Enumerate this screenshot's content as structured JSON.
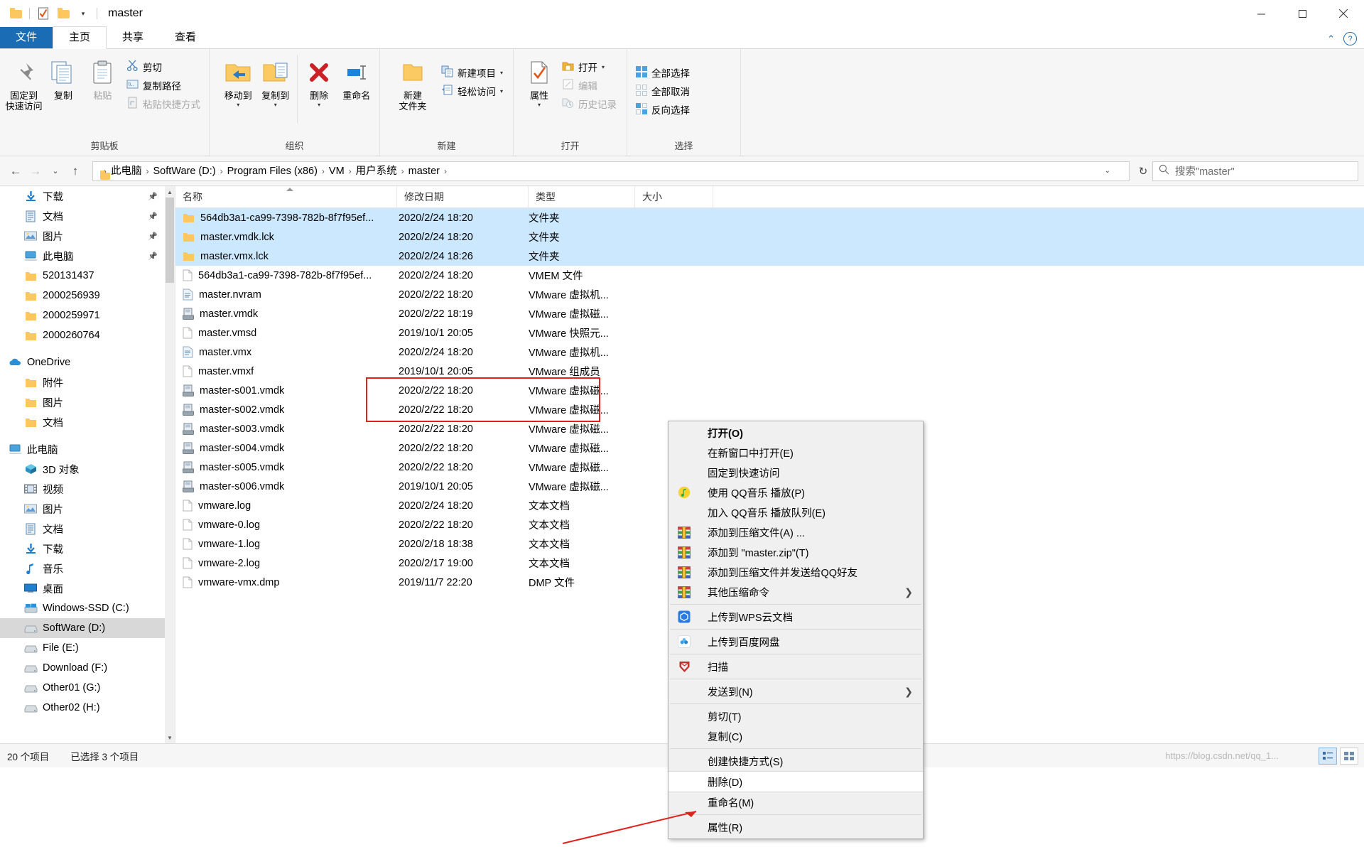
{
  "window": {
    "title": "master",
    "minimize": "—",
    "maximize": "❐",
    "close": "✕",
    "qat_icons": [
      "folder-icon",
      "properties-check-icon",
      "new-folder-icon",
      "customize-dropdown-icon"
    ]
  },
  "tabs": [
    {
      "label": "文件",
      "kind": "file"
    },
    {
      "label": "主页",
      "kind": "active"
    },
    {
      "label": "共享",
      "kind": "normal"
    },
    {
      "label": "查看",
      "kind": "normal"
    }
  ],
  "ribbon_right": {
    "collapse": "⌃",
    "help": "?"
  },
  "ribbon": {
    "groups": [
      {
        "label": "剪贴板",
        "big": [
          {
            "label": "固定到\n快速访问",
            "icon": "pin-icon",
            "disabled": false
          },
          {
            "label": "复制",
            "icon": "copy-icon",
            "disabled": false
          },
          {
            "label": "粘贴",
            "icon": "paste-icon",
            "disabled": true
          }
        ],
        "small": [
          {
            "label": "剪切",
            "icon": "scissors-icon",
            "disabled": false
          },
          {
            "label": "复制路径",
            "icon": "copy-path-icon",
            "disabled": false
          },
          {
            "label": "粘贴快捷方式",
            "icon": "paste-shortcut-icon",
            "disabled": true
          }
        ]
      },
      {
        "label": "组织",
        "big": [
          {
            "label": "移动到",
            "icon": "move-to-icon",
            "caret": true
          },
          {
            "label": "复制到",
            "icon": "copy-to-icon",
            "caret": true
          },
          {
            "label": "删除",
            "icon": "delete-x-icon",
            "caret": true
          },
          {
            "label": "重命名",
            "icon": "rename-icon",
            "caret": false
          }
        ],
        "small": []
      },
      {
        "label": "新建",
        "big": [
          {
            "label": "新建\n文件夹",
            "icon": "new-folder-icon",
            "caret": false
          }
        ],
        "small": [
          {
            "label": "新建项目",
            "icon": "new-item-icon",
            "caret": true
          },
          {
            "label": "轻松访问",
            "icon": "easy-access-icon",
            "caret": true
          }
        ]
      },
      {
        "label": "打开",
        "big": [
          {
            "label": "属性",
            "icon": "properties-icon",
            "caret": true
          }
        ],
        "small": [
          {
            "label": "打开",
            "icon": "open-folder-icon",
            "caret": true,
            "disabled": false
          },
          {
            "label": "编辑",
            "icon": "edit-icon",
            "disabled": true
          },
          {
            "label": "历史记录",
            "icon": "history-icon",
            "disabled": true
          }
        ]
      },
      {
        "label": "选择",
        "big": [],
        "small": [
          {
            "label": "全部选择",
            "icon": "select-all-icon"
          },
          {
            "label": "全部取消",
            "icon": "select-none-icon"
          },
          {
            "label": "反向选择",
            "icon": "invert-selection-icon"
          }
        ]
      }
    ]
  },
  "address": {
    "back": "←",
    "forward": "→",
    "recent": "⌄",
    "up": "↑",
    "crumbs": [
      "此电脑",
      "SoftWare (D:)",
      "Program Files (x86)",
      "VM",
      "用户系统",
      "master"
    ],
    "separator": "›",
    "dropdown": "⌄",
    "refresh": "↻"
  },
  "search": {
    "placeholder": "搜索\"master\"",
    "icon": "search-icon",
    "value": ""
  },
  "navpane": {
    "items": [
      {
        "label": "下载",
        "icon": "download-icon",
        "indent": 1,
        "pinned": true
      },
      {
        "label": "文档",
        "icon": "documents-icon",
        "indent": 1,
        "pinned": true
      },
      {
        "label": "图片",
        "icon": "pictures-icon",
        "indent": 1,
        "pinned": true
      },
      {
        "label": "此电脑",
        "icon": "this-pc-icon",
        "indent": 1,
        "pinned": true
      },
      {
        "label": "520131437",
        "icon": "folder-icon",
        "indent": 1
      },
      {
        "label": "2000256939",
        "icon": "folder-icon",
        "indent": 1
      },
      {
        "label": "2000259971",
        "icon": "folder-icon",
        "indent": 1
      },
      {
        "label": "2000260764",
        "icon": "folder-icon",
        "indent": 1
      },
      {
        "label": "",
        "icon": "spacer",
        "indent": 0,
        "spacer": true
      },
      {
        "label": "OneDrive",
        "icon": "onedrive-icon",
        "indent": 0
      },
      {
        "label": "附件",
        "icon": "folder-icon",
        "indent": 1
      },
      {
        "label": "图片",
        "icon": "folder-icon",
        "indent": 1
      },
      {
        "label": "文档",
        "icon": "folder-icon",
        "indent": 1
      },
      {
        "label": "",
        "icon": "spacer",
        "indent": 0,
        "spacer": true
      },
      {
        "label": "此电脑",
        "icon": "this-pc-icon",
        "indent": 0
      },
      {
        "label": "3D 对象",
        "icon": "3d-objects-icon",
        "indent": 1
      },
      {
        "label": "视频",
        "icon": "videos-icon",
        "indent": 1
      },
      {
        "label": "图片",
        "icon": "pictures-icon",
        "indent": 1
      },
      {
        "label": "文档",
        "icon": "documents-icon",
        "indent": 1
      },
      {
        "label": "下载",
        "icon": "download-icon",
        "indent": 1
      },
      {
        "label": "音乐",
        "icon": "music-icon",
        "indent": 1
      },
      {
        "label": "桌面",
        "icon": "desktop-icon",
        "indent": 1
      },
      {
        "label": "Windows-SSD (C:)",
        "icon": "windows-drive-icon",
        "indent": 1
      },
      {
        "label": "SoftWare (D:)",
        "icon": "drive-icon",
        "indent": 1,
        "selected": true
      },
      {
        "label": "File (E:)",
        "icon": "drive-icon",
        "indent": 1
      },
      {
        "label": "Download (F:)",
        "icon": "drive-icon",
        "indent": 1
      },
      {
        "label": "Other01 (G:)",
        "icon": "drive-icon",
        "indent": 1
      },
      {
        "label": "Other02 (H:)",
        "icon": "drive-icon",
        "indent": 1
      }
    ]
  },
  "filelist": {
    "columns": [
      {
        "label": "名称",
        "key": "name",
        "sorted": true
      },
      {
        "label": "修改日期",
        "key": "date"
      },
      {
        "label": "类型",
        "key": "type"
      },
      {
        "label": "大小",
        "key": "size"
      }
    ],
    "rows": [
      {
        "name": "564db3a1-ca99-7398-782b-8f7f95ef...",
        "date": "2020/2/24 18:20",
        "type": "文件夹",
        "size": "",
        "icon": "folder-icon",
        "selected": true
      },
      {
        "name": "master.vmdk.lck",
        "date": "2020/2/24 18:20",
        "type": "文件夹",
        "size": "",
        "icon": "folder-icon",
        "selected": true
      },
      {
        "name": "master.vmx.lck",
        "date": "2020/2/24 18:26",
        "type": "文件夹",
        "size": "",
        "icon": "folder-icon",
        "selected": true
      },
      {
        "name": "564db3a1-ca99-7398-782b-8f7f95ef...",
        "date": "2020/2/24 18:20",
        "type": "VMEM 文件",
        "size": "",
        "icon": "file-icon"
      },
      {
        "name": "master.nvram",
        "date": "2020/2/22 18:20",
        "type": "VMware 虚拟机...",
        "size": "",
        "icon": "nvram-icon"
      },
      {
        "name": "master.vmdk",
        "date": "2020/2/22 18:19",
        "type": "VMware 虚拟磁...",
        "size": "",
        "icon": "vmdk-icon"
      },
      {
        "name": "master.vmsd",
        "date": "2019/10/1 20:05",
        "type": "VMware 快照元...",
        "size": "",
        "icon": "file-icon"
      },
      {
        "name": "master.vmx",
        "date": "2020/2/24 18:20",
        "type": "VMware 虚拟机...",
        "size": "",
        "icon": "nvram-icon"
      },
      {
        "name": "master.vmxf",
        "date": "2019/10/1 20:05",
        "type": "VMware 组成员",
        "size": "",
        "icon": "file-icon"
      },
      {
        "name": "master-s001.vmdk",
        "date": "2020/2/22 18:20",
        "type": "VMware 虚拟磁...",
        "size": "",
        "icon": "vmdk-icon"
      },
      {
        "name": "master-s002.vmdk",
        "date": "2020/2/22 18:20",
        "type": "VMware 虚拟磁...",
        "size": "",
        "icon": "vmdk-icon"
      },
      {
        "name": "master-s003.vmdk",
        "date": "2020/2/22 18:20",
        "type": "VMware 虚拟磁...",
        "size": "",
        "icon": "vmdk-icon"
      },
      {
        "name": "master-s004.vmdk",
        "date": "2020/2/22 18:20",
        "type": "VMware 虚拟磁...",
        "size": "",
        "icon": "vmdk-icon"
      },
      {
        "name": "master-s005.vmdk",
        "date": "2020/2/22 18:20",
        "type": "VMware 虚拟磁...",
        "size": "",
        "icon": "vmdk-icon"
      },
      {
        "name": "master-s006.vmdk",
        "date": "2019/10/1 20:05",
        "type": "VMware 虚拟磁...",
        "size": "",
        "icon": "vmdk-icon"
      },
      {
        "name": "vmware.log",
        "date": "2020/2/24 18:20",
        "type": "文本文档",
        "size": "",
        "icon": "file-icon"
      },
      {
        "name": "vmware-0.log",
        "date": "2020/2/22 18:20",
        "type": "文本文档",
        "size": "",
        "icon": "file-icon"
      },
      {
        "name": "vmware-1.log",
        "date": "2020/2/18 18:38",
        "type": "文本文档",
        "size": "",
        "icon": "file-icon"
      },
      {
        "name": "vmware-2.log",
        "date": "2020/2/17 19:00",
        "type": "文本文档",
        "size": "",
        "icon": "file-icon"
      },
      {
        "name": "vmware-vmx.dmp",
        "date": "2019/11/7 22:20",
        "type": "DMP 文件",
        "size": "",
        "icon": "file-icon"
      }
    ]
  },
  "contextmenu": {
    "items": [
      {
        "label": "打开(O)",
        "bold": true,
        "icon": null
      },
      {
        "label": "在新窗口中打开(E)",
        "icon": null
      },
      {
        "label": "固定到快速访问",
        "icon": null
      },
      {
        "label": "使用 QQ音乐 播放(P)",
        "icon": "qq-music-icon"
      },
      {
        "label": "加入 QQ音乐 播放队列(E)",
        "icon": null
      },
      {
        "label": "添加到压缩文件(A) ...",
        "icon": "winrar-icon"
      },
      {
        "label": "添加到 \"master.zip\"(T)",
        "icon": "winrar-icon"
      },
      {
        "label": "添加到压缩文件并发送给QQ好友",
        "icon": "winrar-icon"
      },
      {
        "label": "其他压缩命令",
        "icon": "winrar-icon",
        "submenu": true
      },
      {
        "sep": true
      },
      {
        "label": "上传到WPS云文档",
        "icon": "wps-icon"
      },
      {
        "sep": true
      },
      {
        "label": "上传到百度网盘",
        "icon": "baidu-netdisk-icon"
      },
      {
        "sep": true
      },
      {
        "label": "扫描",
        "icon": "shield-scan-icon"
      },
      {
        "sep": true
      },
      {
        "label": "发送到(N)",
        "icon": null,
        "submenu": true
      },
      {
        "sep": true
      },
      {
        "label": "剪切(T)",
        "icon": null
      },
      {
        "label": "复制(C)",
        "icon": null
      },
      {
        "sep": true
      },
      {
        "label": "创建快捷方式(S)",
        "icon": null
      },
      {
        "label": "删除(D)",
        "icon": null,
        "highlighted": true
      },
      {
        "label": "重命名(M)",
        "icon": null
      },
      {
        "sep": true
      },
      {
        "label": "属性(R)",
        "icon": null
      }
    ]
  },
  "status": {
    "count": "20 个项目",
    "selected": "已选择 3 个项目",
    "watermark": "https://blog.csdn.net/qq_1...",
    "view_details_icon": "details-view-icon",
    "view_tiles_icon": "tiles-view-icon"
  }
}
